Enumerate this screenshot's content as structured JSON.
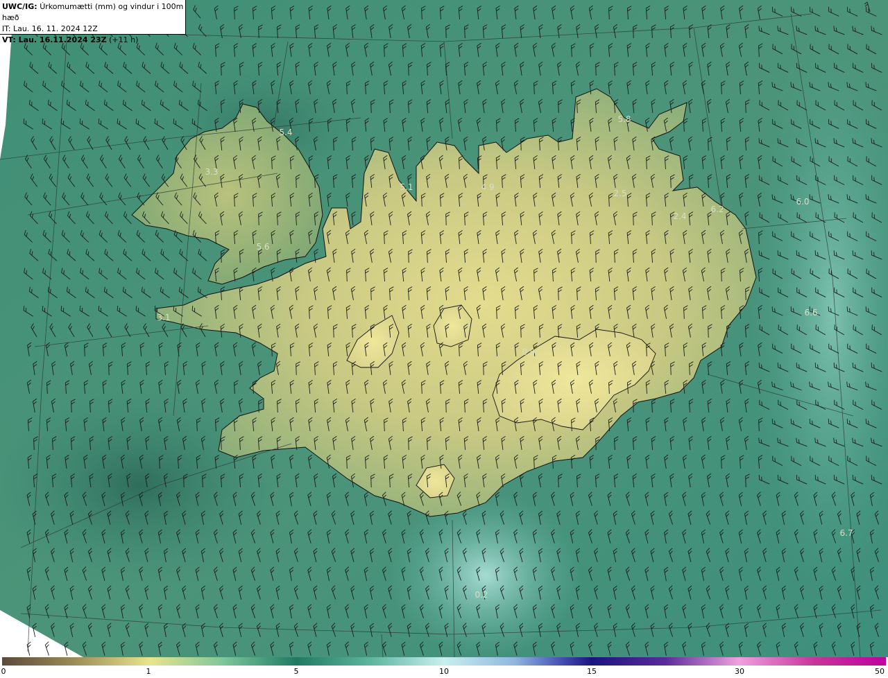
{
  "header": {
    "model": "UWC/IG:",
    "title": "Úrkomumætti (mm) og vindur i 100m hæð",
    "it_line": "IT: Lau. 16. 11. 2024 12Z",
    "vt_bold": "VT: Lau. 16.11.2024 23Z",
    "vt_suffix": "(+11 h)"
  },
  "value_labels": [
    {
      "text": "5.4"
    },
    {
      "text": "3.3"
    },
    {
      "text": "5.6"
    },
    {
      "text": "3.1"
    },
    {
      "text": "5.1"
    },
    {
      "text": "4.9"
    },
    {
      "text": "5.8"
    },
    {
      "text": "2.5"
    },
    {
      "text": "2.4"
    },
    {
      "text": "6.2"
    },
    {
      "text": "6.0"
    },
    {
      "text": "6.6"
    },
    {
      "text": "0.9"
    },
    {
      "text": "6.7"
    },
    {
      "text": "0.2"
    }
  ],
  "colorbar": {
    "ticks": [
      "0",
      "1",
      "5",
      "10",
      "15",
      "30",
      "50"
    ],
    "colors": [
      "#5b4a3a",
      "#9a8a55",
      "#e9e48c",
      "#7fc79b",
      "#1e7a63",
      "#5fb8a2",
      "#c8f0ee",
      "#8fb7e0",
      "#4a55b8",
      "#1b1480",
      "#5a2a9a",
      "#b05ab8",
      "#f0a0e0",
      "#c8339a",
      "#c000a0"
    ]
  },
  "colors": {
    "sea": "#3f8a76",
    "land_high": "#e0d98c",
    "coastline": "#111111",
    "graticule": "#2a3a33",
    "barb": "#1a1a1a"
  },
  "icons": {
    "north_arrow": "north-arrow-icon"
  }
}
